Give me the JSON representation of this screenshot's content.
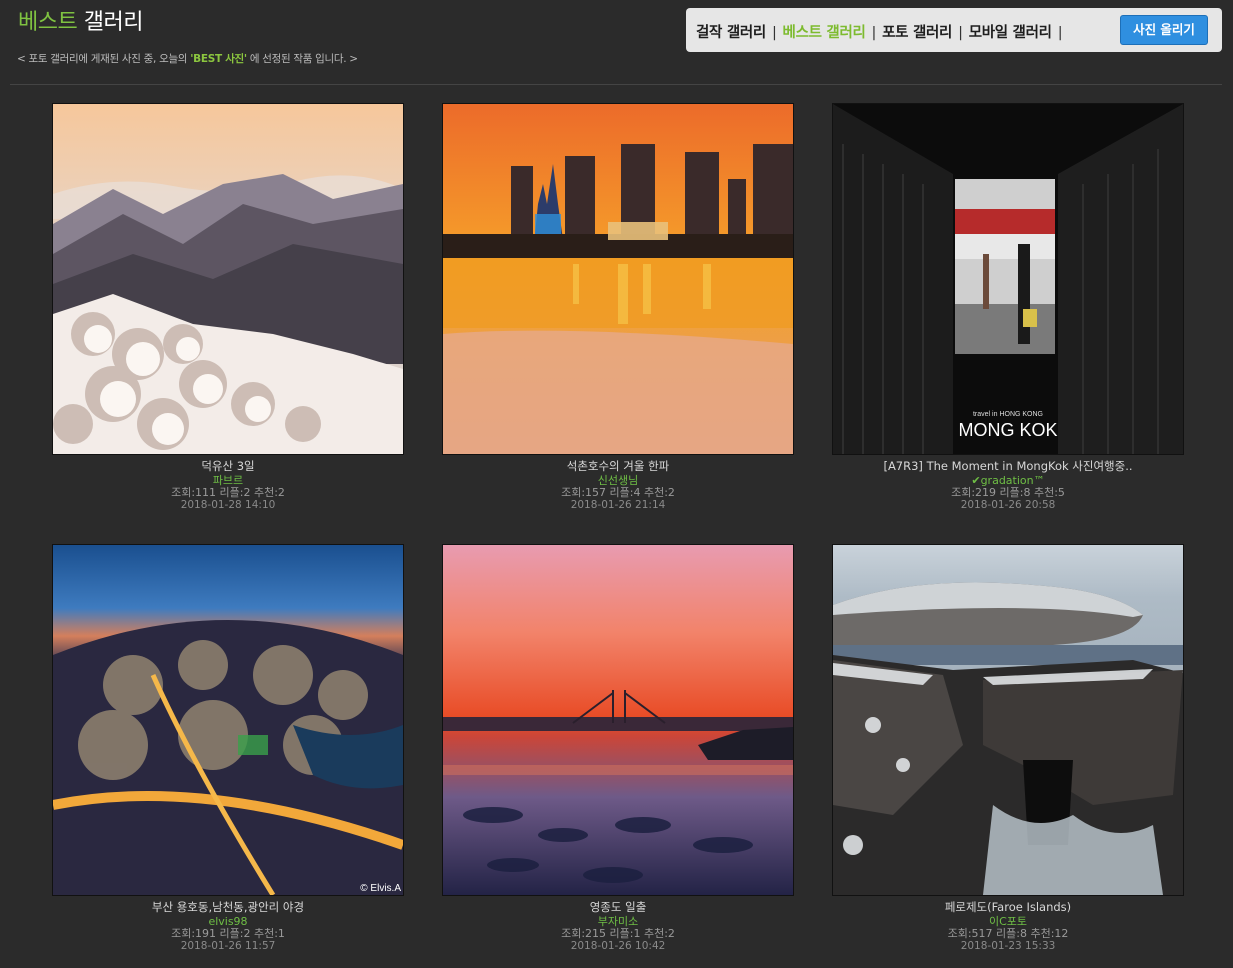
{
  "header": {
    "title_accent": "베스트",
    "title_rest": "갤러리",
    "subtitle_pre": "< 포토 갤러리에 게재된 사진 중, 오늘의",
    "subtitle_best": "'BEST 사진'",
    "subtitle_post": "에 선정된 작품 입니다. >"
  },
  "nav": {
    "items": [
      "걸작 갤러리",
      "베스트 갤러리",
      "포토 갤러리",
      "모바일 갤러리"
    ],
    "separator": "|",
    "active_index": 1,
    "upload_label": "사진 올리기",
    "upload_color": "#2f8fe0",
    "accent_color": "#7dbb2f"
  },
  "gallery": [
    {
      "title": "덕유산 3일",
      "author": "파브르",
      "stats": "조회:111 리플:2 추천:2",
      "date": "2018-01-28 14:10",
      "scene": "snow-mountain"
    },
    {
      "title": "석촌호수의 겨울 한파",
      "author": "신선생님",
      "stats": "조회:157 리플:4 추천:2",
      "date": "2018-01-26 21:14",
      "scene": "city-lake-sunset"
    },
    {
      "title": "[A7R3] The Moment in MongKok 사진여행중..",
      "author": "✔gradation™",
      "stats": "조회:219 리플:8 추천:5",
      "date": "2018-01-26 20:58",
      "scene": "mongkok-alley",
      "caption_small": "travel in HONG KONG",
      "caption_big": "MONG KOK"
    },
    {
      "title": "부산 용호동,남천동,광안리 야경",
      "author": "elvis98",
      "stats": "조회:191 리플:2 추천:1",
      "date": "2018-01-26 11:57",
      "scene": "busan-night",
      "watermark": "© Elvis.A"
    },
    {
      "title": "영종도 일출",
      "author": "부자미소",
      "stats": "조회:215 리플:1 추천:2",
      "date": "2018-01-26 10:42",
      "scene": "bridge-sunrise"
    },
    {
      "title": "페로제도(Faroe Islands)",
      "author": "이C포토",
      "stats": "조회:517 리플:8 추천:12",
      "date": "2018-01-23 15:33",
      "scene": "faroe-cliff"
    }
  ]
}
